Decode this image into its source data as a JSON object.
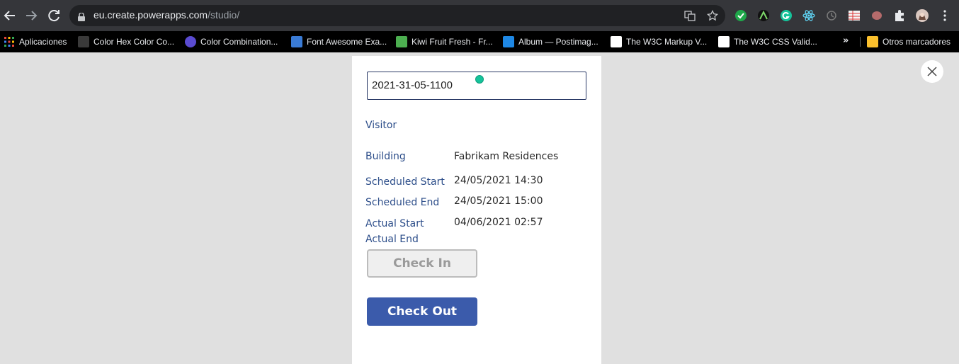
{
  "browser": {
    "url_host": "eu.create.powerapps.com",
    "url_path": "/studio/",
    "bookmarks": [
      {
        "label": "Aplicaciones",
        "color": "#e8453c"
      },
      {
        "label": "Color Hex Color Co...",
        "color": "#6b6b6b"
      },
      {
        "label": "Color Combination...",
        "color": "#5a4bd1"
      },
      {
        "label": "Font Awesome Exa...",
        "color": "#3a7bd5"
      },
      {
        "label": "Kiwi Fruit Fresh - Fr...",
        "color": "#4caf50"
      },
      {
        "label": "Album — Postimag...",
        "color": "#1e88e5"
      },
      {
        "label": "The W3C Markup V...",
        "color": "#ffffff"
      },
      {
        "label": "The W3C CSS Valid...",
        "color": "#ffffff"
      }
    ],
    "other_bookmarks": "Otros marcadores",
    "overflow": "»"
  },
  "form": {
    "id_value": "2021-31-05-1100",
    "visitor_label": "Visitor",
    "building_label": "Building",
    "building_value": "Fabrikam Residences",
    "scheduled_start_label": "Scheduled Start",
    "scheduled_start_value": "24/05/2021 14:30",
    "scheduled_end_label": "Scheduled End",
    "scheduled_end_value": "24/05/2021 15:00",
    "actual_start_label": "Actual Start",
    "actual_start_value": "04/06/2021 02:57",
    "actual_end_label": "Actual End",
    "check_in_label": "Check In",
    "check_out_label": "Check Out"
  },
  "colors": {
    "label_blue": "#2d4e8a",
    "checkout_blue": "#3b5bab"
  }
}
